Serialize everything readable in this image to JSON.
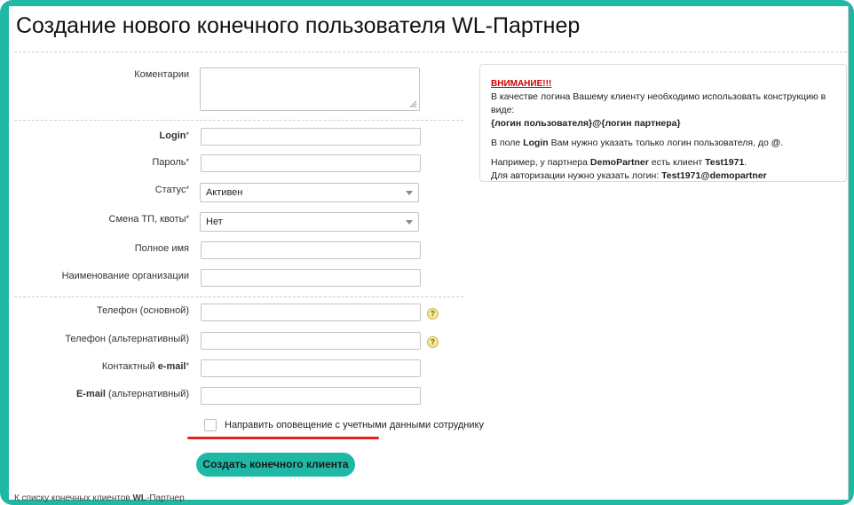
{
  "page": {
    "title": "Создание нового конечного пользователя WL-Партнер"
  },
  "form": {
    "comments": {
      "label": "Коментарии",
      "value": ""
    },
    "login": {
      "label": "Login",
      "required_mark": "*",
      "value": ""
    },
    "password": {
      "label": "Пароль",
      "required_mark": "*",
      "value": ""
    },
    "status": {
      "label": "Статус",
      "required_mark": "*",
      "selected": "Активен"
    },
    "tp_change": {
      "label": "Смена ТП, квоты",
      "required_mark": "*",
      "selected": "Нет"
    },
    "full_name": {
      "label": "Полное имя",
      "value": ""
    },
    "org_name": {
      "label": "Наименование организации",
      "value": ""
    },
    "phone_main": {
      "label": "Телефон (основной)",
      "value": "",
      "help": "?"
    },
    "phone_alt": {
      "label": "Телефон (альтернативный)",
      "value": "",
      "help": "?"
    },
    "email": {
      "label_prefix": "Контактный ",
      "label_bold": "e-mail",
      "required_mark": "*",
      "value": ""
    },
    "email_alt": {
      "label_bold": "E-mail",
      "label_suffix": " (альтернативный)",
      "value": ""
    },
    "notify": {
      "label": "Направить оповещение с учетными данными сотруднику",
      "checked": false
    },
    "submit_label": "Создать конечного клиента"
  },
  "back_link": {
    "prefix": "К списку конечных клиентов ",
    "bold": "WL",
    "suffix": "-Партнер"
  },
  "notice": {
    "title": "ВНИМАНИЕ!!!",
    "line1": "В качестве логина Вашему клиенту необходимо использовать конструкцию в виде:",
    "line2": "{логин пользователя}@{логин партнера}",
    "line3_prefix": "В поле ",
    "line3_bold": "Login",
    "line3_mid": " Вам нужно указать только логин пользователя, до ",
    "line3_at": "@",
    "line3_end": ".",
    "line4_prefix": "Например, у партнера ",
    "line4_partner": "DemoPartner",
    "line4_mid": " есть клиент ",
    "line4_client": "Test1971",
    "line4_end": ".",
    "line5_prefix": "Для авторизации нужно указать логин: ",
    "line5_login": "Test1971@demopartner"
  },
  "colors": {
    "accent": "#1fb8a5",
    "warning": "#d10000",
    "highlight_line": "#e52222"
  }
}
